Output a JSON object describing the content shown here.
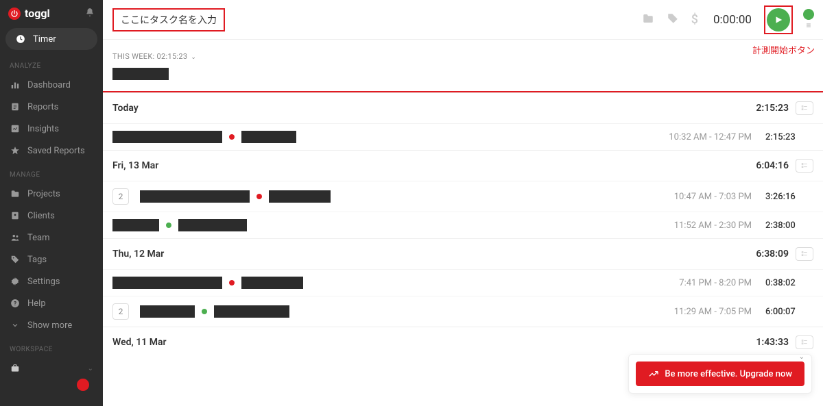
{
  "logo": "toggl",
  "sidebar": {
    "timer": "Timer",
    "sections": {
      "analyze": "ANALYZE",
      "manage": "MANAGE",
      "workspace": "WORKSPACE"
    },
    "dashboard": "Dashboard",
    "reports": "Reports",
    "insights": "Insights",
    "saved_reports": "Saved Reports",
    "projects": "Projects",
    "clients": "Clients",
    "team": "Team",
    "tags": "Tags",
    "settings": "Settings",
    "help": "Help",
    "show_more": "Show more"
  },
  "topbar": {
    "task_placeholder": "ここにタスク名を入力",
    "timer": "0:00:00"
  },
  "annotation": "計測開始ボタン",
  "week_summary": {
    "label": "THIS WEEK:",
    "total": "02:15:23"
  },
  "days": [
    {
      "label": "Today",
      "total": "2:15:23",
      "entries": [
        {
          "count": null,
          "bars": [
            160,
            80
          ],
          "dot": "red",
          "time": "10:32 AM - 12:47 PM",
          "dur": "2:15:23"
        }
      ]
    },
    {
      "label": "Fri, 13 Mar",
      "total": "6:04:16",
      "entries": [
        {
          "count": "2",
          "bars": [
            160,
            90
          ],
          "dot": "red",
          "time": "10:47 AM - 7:03 PM",
          "dur": "3:26:16"
        },
        {
          "count": null,
          "bars": [
            68,
            100
          ],
          "dot": "green",
          "time": "11:52 AM - 2:30 PM",
          "dur": "2:38:00"
        }
      ]
    },
    {
      "label": "Thu, 12 Mar",
      "total": "6:38:09",
      "entries": [
        {
          "count": null,
          "bars": [
            160,
            90
          ],
          "dot": "red",
          "time": "7:41 PM - 8:20 PM",
          "dur": "0:38:02"
        },
        {
          "count": "2",
          "bars": [
            80,
            110
          ],
          "dot": "green",
          "time": "11:29 AM - 7:05 PM",
          "dur": "6:00:07"
        }
      ]
    },
    {
      "label": "Wed, 11 Mar",
      "total": "1:43:33",
      "entries": []
    }
  ],
  "upgrade": "Be more effective. Upgrade now"
}
